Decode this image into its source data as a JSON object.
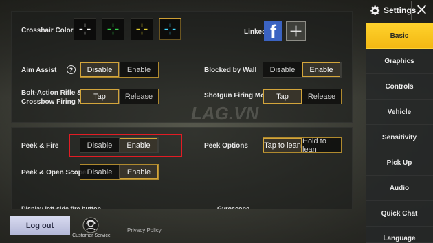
{
  "header": {
    "title": "Settings",
    "close_icon": "close-icon",
    "gear_icon": "gear-icon"
  },
  "sidebar": {
    "items": [
      {
        "label": "Basic",
        "active": true
      },
      {
        "label": "Graphics"
      },
      {
        "label": "Controls"
      },
      {
        "label": "Vehicle"
      },
      {
        "label": "Sensitivity"
      },
      {
        "label": "Pick Up"
      },
      {
        "label": "Audio"
      },
      {
        "label": "Quick Chat"
      },
      {
        "label": "Language"
      }
    ]
  },
  "crosshair": {
    "label": "Crosshair Color",
    "colors": [
      "#ffffff",
      "#34d34b",
      "#e6d233",
      "#3fd6ff"
    ],
    "selected_index": 3
  },
  "linked": {
    "label": "Linked",
    "facebook_letter": "f"
  },
  "aim_assist": {
    "label": "Aim Assist",
    "help": "?",
    "options": [
      "Disable",
      "Enable"
    ],
    "selected": "Disable"
  },
  "blocked_by_wall": {
    "label": "Blocked by Wall",
    "options": [
      "Disable",
      "Enable"
    ],
    "selected": "Enable"
  },
  "bolt_action": {
    "label": "Bolt-Action Rifle &\nCrossbow Firing Mode",
    "options": [
      "Tap",
      "Release"
    ],
    "selected": "Tap"
  },
  "shotgun": {
    "label": "Shotgun Firing Mode",
    "options": [
      "Tap",
      "Release"
    ],
    "selected": "Tap"
  },
  "peek_fire": {
    "label": "Peek & Fire",
    "options": [
      "Disable",
      "Enable"
    ],
    "selected": "Enable"
  },
  "peek_options": {
    "label": "Peek Options",
    "options": [
      "Tap to lean",
      "Hold to lean"
    ],
    "selected": "Tap to lean"
  },
  "peek_scope": {
    "label": "Peek & Open Scope",
    "options": [
      "Disable",
      "Enable"
    ],
    "selected": "Enable"
  },
  "cut_rows": {
    "left": "Display left-side fire button",
    "right": "Gyroscope"
  },
  "footer": {
    "logout": "Log out",
    "customer_service": "Customer Service",
    "privacy": "Privacy Policy"
  },
  "watermark": "LAG.VN",
  "colors": {
    "accent": "#f7c21c",
    "selection_border": "#c9982e",
    "highlight_box": "#e21c24",
    "facebook": "#3b63c2"
  }
}
